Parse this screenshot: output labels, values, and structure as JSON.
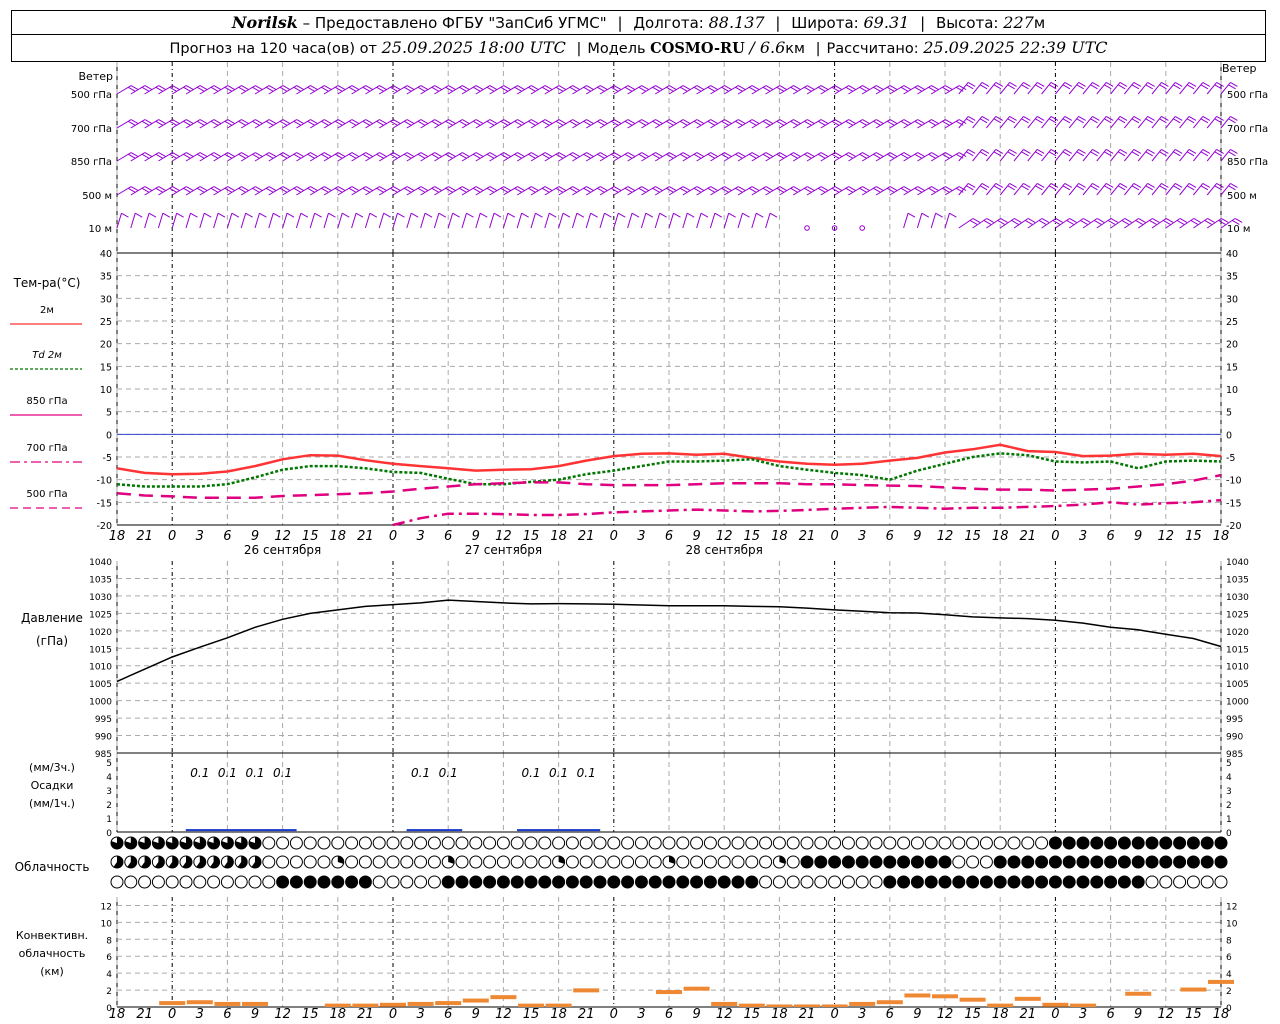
{
  "header": {
    "station": "Norilsk",
    "dash": "–",
    "provider": "Предоставлено ФГБУ \"ЗапСиб УГМС\"",
    "lon_label": "Долгота:",
    "lon_value": "88.137",
    "lat_label": "Широта:",
    "lat_value": "69.31",
    "alt_label": "Высота:",
    "alt_value": "227",
    "alt_unit": "м",
    "forecast_label": "Прогноз на 120 часа(ов) от",
    "forecast_from": "25.09.2025 18:00 UTC",
    "model_label": "Модель",
    "model_name": "COSMO-RU",
    "model_res": "/ 6.6",
    "model_res_unit": "км",
    "calc_label": "Рассчитано:",
    "calc_value": "25.09.2025 22:39 UTC"
  },
  "wind_panel": {
    "title": "Ветер",
    "levels": [
      "500 гПа",
      "700 гПа",
      "850 гПа",
      "500 м",
      "10 м"
    ],
    "color": "#9400d3"
  },
  "time_axis": {
    "ticks": [
      "18",
      "21",
      "0",
      "3",
      "6",
      "9",
      "12",
      "15",
      "18",
      "21",
      "0",
      "3",
      "6",
      "9",
      "12",
      "15",
      "18",
      "21",
      "0",
      "3",
      "6",
      "9",
      "12",
      "15",
      "18",
      "21",
      "0"
    ],
    "day_labels": [
      "26 сентября",
      "27 сентября",
      "28 сентября"
    ]
  },
  "temp_panel": {
    "title": "Тем-ра(°С)",
    "legend": [
      {
        "label": "2м",
        "color": "#ff3333",
        "style": "solid"
      },
      {
        "label": "Td 2м",
        "color": "#007700",
        "style": "dotted"
      },
      {
        "label": "850 гПа",
        "color": "#e0007f",
        "style": "solid"
      },
      {
        "label": "700 гПа",
        "color": "#e0007f",
        "style": "dashdot"
      },
      {
        "label": "500 гПа",
        "color": "#e0007f",
        "style": "dashed"
      }
    ]
  },
  "pressure_panel": {
    "title": "Давление",
    "unit": "(гПа)"
  },
  "precip_panel": {
    "label_top": "(мм/3ч.)",
    "label_mid": "Осадки",
    "label_bottom": "(мм/1ч.)",
    "amounts": [
      {
        "t": 9,
        "label": "0.1"
      },
      {
        "t": 12,
        "label": "0.1"
      },
      {
        "t": 15,
        "label": "0.1"
      },
      {
        "t": 18,
        "label": "0.1"
      },
      {
        "t": 33,
        "label": "0.1"
      },
      {
        "t": 36,
        "label": "0.1"
      },
      {
        "t": 45,
        "label": "0.1"
      },
      {
        "t": 48,
        "label": "0.1"
      },
      {
        "t": 51,
        "label": "0.1"
      }
    ]
  },
  "cloud_panel": {
    "title": "Облачность"
  },
  "conv_panel": {
    "label_1": "Конвективн.",
    "label_2": "облачность",
    "label_3": "(км)"
  },
  "chart_data": [
    {
      "type": "line",
      "title": "Тем-ра(°С)",
      "x_unit": "hours from 25.09.2025 18:00 UTC",
      "ylim": [
        -20,
        40
      ],
      "yticks": [
        -20,
        -15,
        -10,
        -5,
        0,
        5,
        10,
        15,
        20,
        25,
        30,
        35,
        40
      ],
      "series": [
        {
          "name": "2м",
          "x": [
            0,
            3,
            6,
            9,
            12,
            15,
            18,
            21,
            24,
            27,
            30,
            33,
            36,
            39,
            42,
            45,
            48,
            51,
            54,
            57,
            60,
            63,
            66,
            69,
            72,
            75,
            78,
            81,
            84,
            87,
            90,
            93,
            96,
            99,
            102,
            105,
            108,
            111,
            114,
            117,
            120
          ],
          "values": [
            -7.5,
            -8.5,
            -8.8,
            -8.7,
            -8.2,
            -7,
            -5.5,
            -4.6,
            -4.7,
            -5.7,
            -6.5,
            -7,
            -7.5,
            -8,
            -7.8,
            -7.7,
            -7,
            -5.8,
            -4.8,
            -4.3,
            -4.2,
            -4.5,
            -4.3,
            -5.2,
            -6,
            -6.5,
            -6.7,
            -6.5,
            -5.8,
            -5.2,
            -4,
            -3.3,
            -2.3,
            -3.7,
            -3.9,
            -4.8,
            -4.7,
            -4.3,
            -4.5,
            -4.3,
            -4.8
          ]
        },
        {
          "name": "Td 2м",
          "x": [
            0,
            3,
            6,
            9,
            12,
            15,
            18,
            21,
            24,
            27,
            30,
            33,
            36,
            39,
            42,
            45,
            48,
            51,
            54,
            57,
            60,
            63,
            66,
            69,
            72,
            75,
            78,
            81,
            84,
            87,
            90,
            93,
            96,
            99,
            102,
            105,
            108,
            111,
            114,
            117,
            120
          ],
          "values": [
            -11,
            -11.5,
            -11.5,
            -11.5,
            -11,
            -9.5,
            -7.8,
            -7,
            -7,
            -7.5,
            -8.3,
            -8.5,
            -9.8,
            -11,
            -11,
            -10.5,
            -10,
            -8.8,
            -8,
            -7,
            -6,
            -6,
            -5.8,
            -5.5,
            -7,
            -7.8,
            -8.5,
            -9,
            -10,
            -8,
            -6.5,
            -5,
            -4.2,
            -4.6,
            -6,
            -6.2,
            -6,
            -7.5,
            -6,
            -5.8,
            -6
          ]
        },
        {
          "name": "850 гПа",
          "x": [
            0,
            3,
            6,
            9,
            12,
            15,
            18,
            21,
            24,
            27,
            30,
            33,
            36,
            39,
            42,
            45,
            48,
            51,
            54,
            57,
            60,
            63,
            66,
            69,
            72,
            75,
            78,
            81,
            84,
            87,
            90,
            93,
            96,
            99,
            102,
            105,
            108,
            111,
            114,
            117,
            120
          ],
          "values": [
            -13,
            -13.5,
            -13.7,
            -14,
            -14,
            -14,
            -13.6,
            -13.4,
            -13.2,
            -13,
            -12.6,
            -12,
            -11.5,
            -11,
            -10.8,
            -10.6,
            -10.6,
            -11,
            -11.2,
            -11.2,
            -11.2,
            -11,
            -10.8,
            -10.8,
            -10.8,
            -11,
            -11,
            -11.2,
            -11.3,
            -11.4,
            -11.7,
            -12,
            -12.2,
            -12.2,
            -12.4,
            -12.2,
            -12,
            -11.5,
            -11,
            -10.2,
            -9
          ]
        },
        {
          "name": "700 гПа",
          "x": [
            30,
            33,
            36,
            39,
            42,
            45,
            48,
            51,
            54,
            57,
            60,
            63,
            66,
            69,
            72,
            75,
            78,
            81,
            84,
            87,
            90,
            93,
            96,
            99,
            102,
            105,
            108,
            111,
            114,
            117,
            120
          ],
          "values": [
            -20,
            -18.5,
            -17.5,
            -17.5,
            -17.6,
            -17.8,
            -17.8,
            -17.6,
            -17.2,
            -17,
            -16.8,
            -16.6,
            -16.8,
            -17,
            -16.9,
            -16.7,
            -16.4,
            -16.2,
            -16,
            -16.2,
            -16.4,
            -16.2,
            -16.2,
            -16,
            -15.8,
            -15.5,
            -15,
            -15.5,
            -15.2,
            -15,
            -14.5
          ]
        }
      ]
    },
    {
      "type": "line",
      "title": "Давление",
      "ylim": [
        985,
        1040
      ],
      "yticks": [
        985,
        990,
        995,
        1000,
        1005,
        1010,
        1015,
        1020,
        1025,
        1030,
        1035,
        1040
      ],
      "series": [
        {
          "name": "Давление",
          "x": [
            0,
            3,
            6,
            9,
            12,
            15,
            18,
            21,
            24,
            27,
            30,
            33,
            36,
            39,
            42,
            45,
            48,
            51,
            54,
            57,
            60,
            63,
            66,
            69,
            72,
            75,
            78,
            81,
            84,
            87,
            90,
            93,
            96,
            99,
            102,
            105,
            108,
            111,
            114,
            117,
            120
          ],
          "values": [
            1005.5,
            1009,
            1012.5,
            1015.3,
            1018,
            1021,
            1023.3,
            1025,
            1026,
            1027,
            1027.5,
            1028,
            1028.8,
            1028.4,
            1028,
            1027.7,
            1027.8,
            1027.7,
            1027.6,
            1027.4,
            1027.2,
            1027.2,
            1027.2,
            1027,
            1026.9,
            1026.5,
            1026,
            1025.6,
            1025.2,
            1025.1,
            1024.6,
            1024,
            1023.7,
            1023.5,
            1023,
            1022.2,
            1021,
            1020.3,
            1019,
            1017.8,
            1015.5
          ]
        }
      ]
    },
    {
      "type": "bar",
      "title": "Осадки",
      "ylim": [
        0,
        5
      ],
      "yticks": [
        0,
        1,
        2,
        3,
        4,
        5
      ],
      "x": [
        9,
        12,
        15,
        18,
        33,
        36,
        45,
        48,
        51
      ],
      "values": [
        0.1,
        0.1,
        0.1,
        0.1,
        0.1,
        0.1,
        0.1,
        0.1,
        0.1
      ]
    },
    {
      "type": "bar",
      "title": "Конвективн. облачность (км)",
      "ylim": [
        0,
        13
      ],
      "yticks": [
        0,
        2,
        4,
        6,
        8,
        10,
        12
      ],
      "x": [
        6,
        9,
        12,
        15,
        24,
        27,
        30,
        33,
        36,
        39,
        42,
        45,
        48,
        51,
        54,
        57,
        60,
        63,
        66,
        69,
        72,
        75,
        78,
        81,
        84,
        87,
        90,
        93,
        96,
        99,
        102,
        105,
        108,
        111,
        114,
        117,
        120
      ],
      "values": [
        0.7,
        0.8,
        0.6,
        0.6,
        0.4,
        0.4,
        0.5,
        0.6,
        0.7,
        1.0,
        1.4,
        0.4,
        0.4,
        2.2,
        0,
        0,
        2,
        2.4,
        0.6,
        0.4,
        0.3,
        0.3,
        0.3,
        0.6,
        0.8,
        1.6,
        1.5,
        1.1,
        0.4,
        1.2,
        0.5,
        0.4,
        0,
        1.8,
        0,
        2.3,
        3.2
      ]
    }
  ]
}
